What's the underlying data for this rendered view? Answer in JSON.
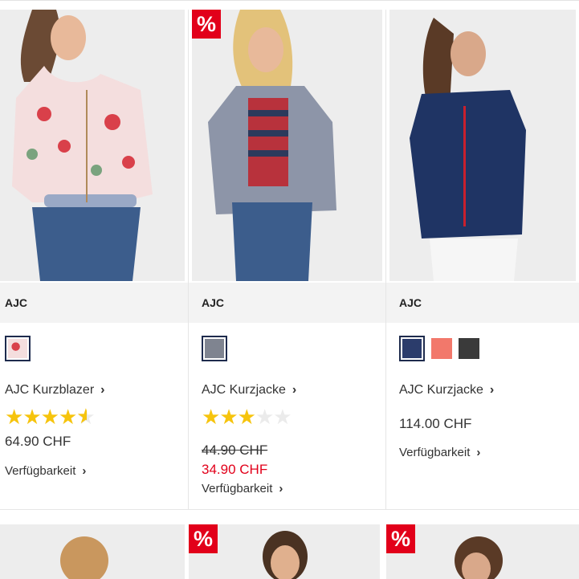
{
  "products": [
    {
      "brand": "AJC",
      "name": "AJC Kurzblazer",
      "rating": 4.5,
      "rating_text": "★★★★★",
      "price": "64.90 CHF",
      "old_price": "",
      "availability": "Verfügbarkeit",
      "sale_badge": "",
      "swatches": [
        "floral"
      ]
    },
    {
      "brand": "AJC",
      "name": "AJC Kurzjacke",
      "rating": 3,
      "old_price": "44.90 CHF",
      "price": "34.90 CHF",
      "availability": "Verfügbarkeit",
      "sale_badge": "%",
      "swatches": [
        "#7f8490"
      ]
    },
    {
      "brand": "AJC",
      "name": "AJC Kurzjacke",
      "price": "114.00 CHF",
      "availability": "Verfügbarkeit",
      "sale_badge": "",
      "swatches": [
        "#2b3c6b",
        "#f2786b",
        "#3a3a3a"
      ]
    }
  ],
  "row2": {
    "badges": [
      "%",
      "%"
    ]
  },
  "colors": {
    "sale_red": "#e2001a",
    "star_yellow": "#f6c40d",
    "selected_border": "#1e2b4d"
  }
}
